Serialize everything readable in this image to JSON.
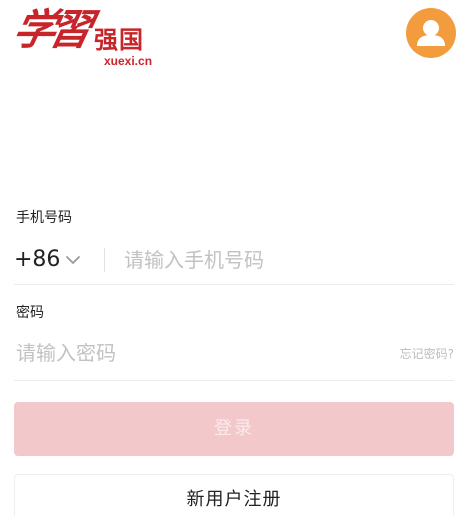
{
  "header": {
    "logo": {
      "brush_text": "学習",
      "strong_text": "强国",
      "domain_text": "xuexi.cn"
    },
    "avatar_icon": "user-avatar-icon"
  },
  "colors": {
    "brand_red": "#c8252b",
    "avatar_orange": "#f39c3e",
    "login_button_disabled": "#f3c8cb"
  },
  "form": {
    "phone": {
      "label": "手机号码",
      "country_code": "+86",
      "dropdown_icon": "chevron-down-icon",
      "placeholder": "请输入手机号码",
      "value": ""
    },
    "password": {
      "label": "密码",
      "placeholder": "请输入密码",
      "value": "",
      "forgot_label": "忘记密码?"
    },
    "login_label": "登录",
    "register_label": "新用户注册"
  }
}
